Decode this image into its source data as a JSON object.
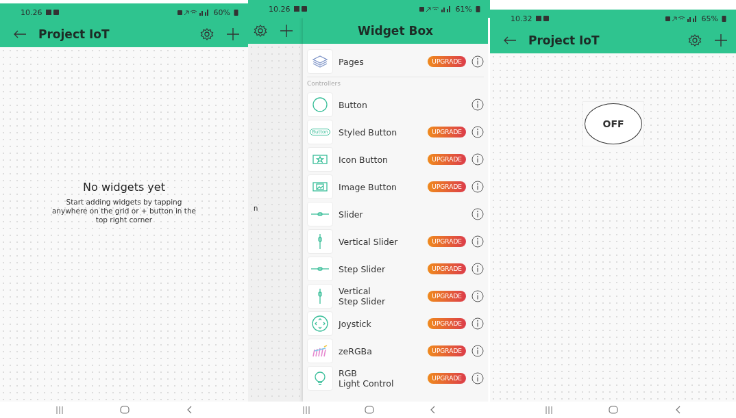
{
  "screens": [
    {
      "kind": "project",
      "status": {
        "time": "10.26",
        "battery": "60%"
      },
      "app_bar": {
        "title": "Project IoT"
      },
      "empty_state": {
        "title": "No widgets yet",
        "message": "Start adding widgets by tapping anywhere on the grid or + button in the top right corner"
      }
    },
    {
      "kind": "widget_box",
      "status": {
        "time": "10.26",
        "battery": "61%"
      },
      "behind": {
        "fragment": "n"
      },
      "drawer": {
        "title": "Widget Box",
        "items": [
          {
            "kind": "pages",
            "label": "Pages",
            "badge": "UPGRADE"
          },
          {
            "kind": "section",
            "label": "Controllers"
          },
          {
            "kind": "button",
            "label": "Button"
          },
          {
            "kind": "styled-button",
            "label": "Styled Button",
            "badge": "UPGRADE",
            "icon_label": "Button"
          },
          {
            "kind": "icon-button",
            "label": "Icon Button",
            "badge": "UPGRADE"
          },
          {
            "kind": "image-button",
            "label": "Image Button",
            "badge": "UPGRADE"
          },
          {
            "kind": "slider",
            "label": "Slider"
          },
          {
            "kind": "vertical-slider",
            "label": "Vertical Slider",
            "badge": "UPGRADE"
          },
          {
            "kind": "slider",
            "label": "Step Slider",
            "badge": "UPGRADE"
          },
          {
            "kind": "vertical-slider",
            "label": "Vertical\nStep Slider",
            "badge": "UPGRADE"
          },
          {
            "kind": "joystick",
            "label": "Joystick",
            "badge": "UPGRADE"
          },
          {
            "kind": "zergba",
            "label": "zeRGBa",
            "badge": "UPGRADE"
          },
          {
            "kind": "rgb-light",
            "label": "RGB\nLight Control",
            "badge": "UPGRADE"
          }
        ]
      }
    },
    {
      "kind": "project",
      "status": {
        "time": "10.32",
        "battery": "65%"
      },
      "app_bar": {
        "title": "Project IoT"
      },
      "widgets": [
        {
          "kind": "button",
          "label": "OFF"
        }
      ]
    }
  ]
}
